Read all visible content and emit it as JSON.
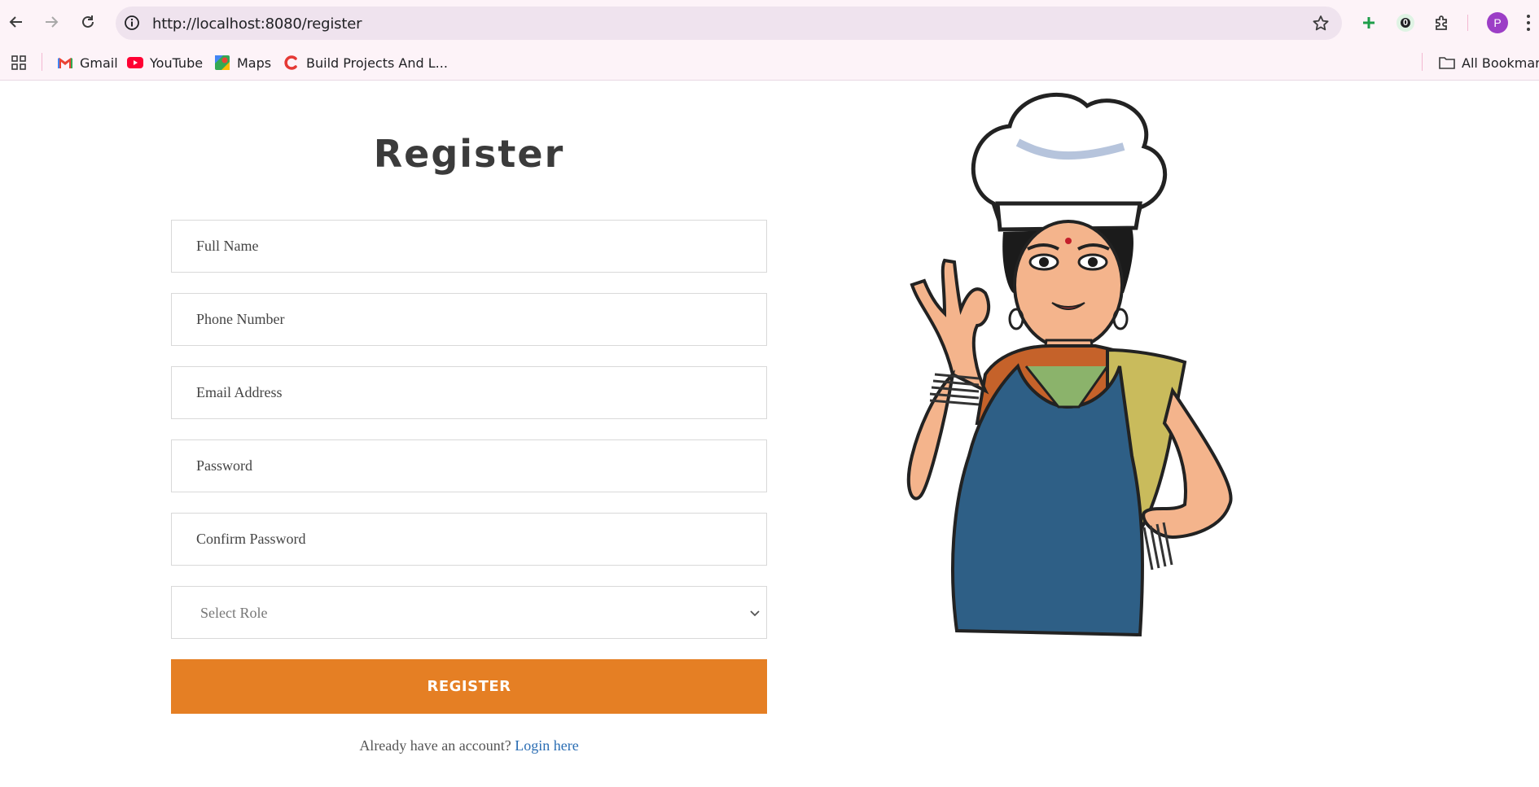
{
  "browser": {
    "url": "http://localhost:8080/register",
    "profile_initial": "P",
    "extension_badge": "0",
    "bookmarks": [
      {
        "label": "Gmail",
        "icon": "gmail-icon"
      },
      {
        "label": "YouTube",
        "icon": "youtube-icon"
      },
      {
        "label": "Maps",
        "icon": "maps-icon"
      },
      {
        "label": "Build Projects And L...",
        "icon": "codedamn-icon"
      }
    ],
    "all_bookmarks_label": "All Bookmarks"
  },
  "form": {
    "title": "Register",
    "fields": {
      "full_name_placeholder": "Full Name",
      "phone_placeholder": "Phone Number",
      "email_placeholder": "Email Address",
      "password_placeholder": "Password",
      "confirm_password_placeholder": "Confirm Password"
    },
    "role_select": {
      "selected": "Select Role"
    },
    "submit_label": "REGISTER",
    "login_prompt": "Already have an account?",
    "login_link": "Login here"
  },
  "colors": {
    "accent": "#e57f24",
    "link": "#2a6db3",
    "title": "#3b3b3b"
  }
}
